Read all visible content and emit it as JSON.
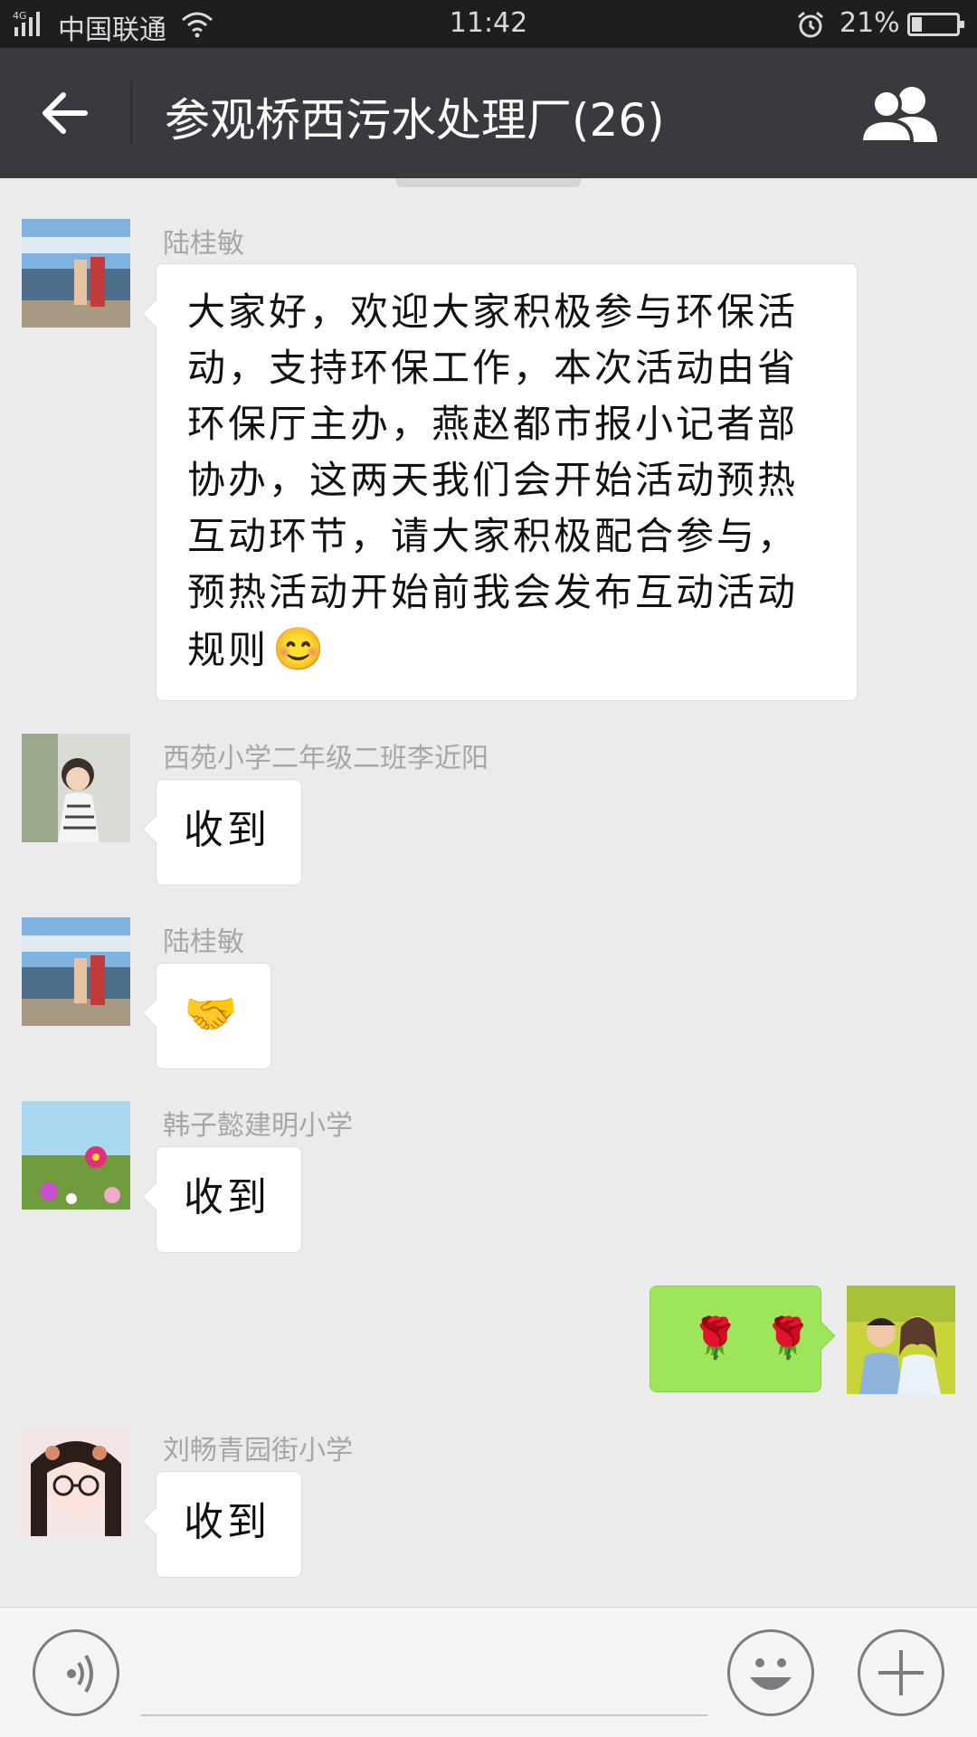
{
  "status_bar": {
    "network": "4G",
    "carrier": "中国联通",
    "time": "11:42",
    "battery": "21%",
    "battery_level": 0.21
  },
  "header": {
    "title": "参观桥西污水处理厂(26)",
    "back_icon": "back-arrow-icon",
    "members_icon": "group-members-icon"
  },
  "messages": [
    {
      "sender": "陆桂敏",
      "lines": [
        "大家好，欢迎大家积极参与环保活",
        "动，支持环保工作，本次活动由省",
        "环保厅主办，燕赵都市报小记者部",
        "协办，这两天我们会开始活动预热",
        "互动环节，请大家积极配合参与，",
        "预热活动开始前我会发布互动活动",
        "规则"
      ],
      "emoji": "😊"
    },
    {
      "sender": "西苑小学二年级二班李近阳",
      "text": "收到"
    },
    {
      "sender": "陆桂敏",
      "emoji": "🤝"
    },
    {
      "sender": "韩子懿建明小学",
      "text": "收到"
    },
    {
      "sender": "",
      "emoji": "🌹 🌹",
      "outgoing": true
    },
    {
      "sender": "刘畅青园街小学",
      "text": "收到"
    }
  ],
  "input_bar": {
    "voice_icon": "voice-input-icon",
    "emoji_icon": "emoji-icon",
    "more_icon": "plus-icon"
  }
}
